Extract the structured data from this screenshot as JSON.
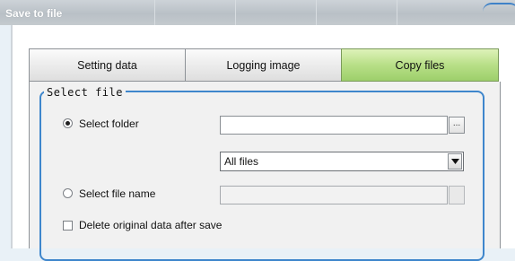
{
  "window": {
    "title": "Save to file"
  },
  "tabs": [
    {
      "label": "Setting data",
      "active": false
    },
    {
      "label": "Logging image",
      "active": false
    },
    {
      "label": "Copy files",
      "active": true
    }
  ],
  "select_file": {
    "legend": "Select file",
    "select_folder": {
      "label": "Select folder",
      "selected": true,
      "path_value": "",
      "browse_label": "..."
    },
    "file_filter": {
      "value": "All files"
    },
    "select_file_name": {
      "label": "Select file name",
      "selected": false,
      "path_value": ""
    },
    "delete_original": {
      "label": "Delete original data after save",
      "checked": false
    }
  },
  "colors": {
    "active_tab": "#b8df87",
    "group_border": "#3e86cc"
  }
}
